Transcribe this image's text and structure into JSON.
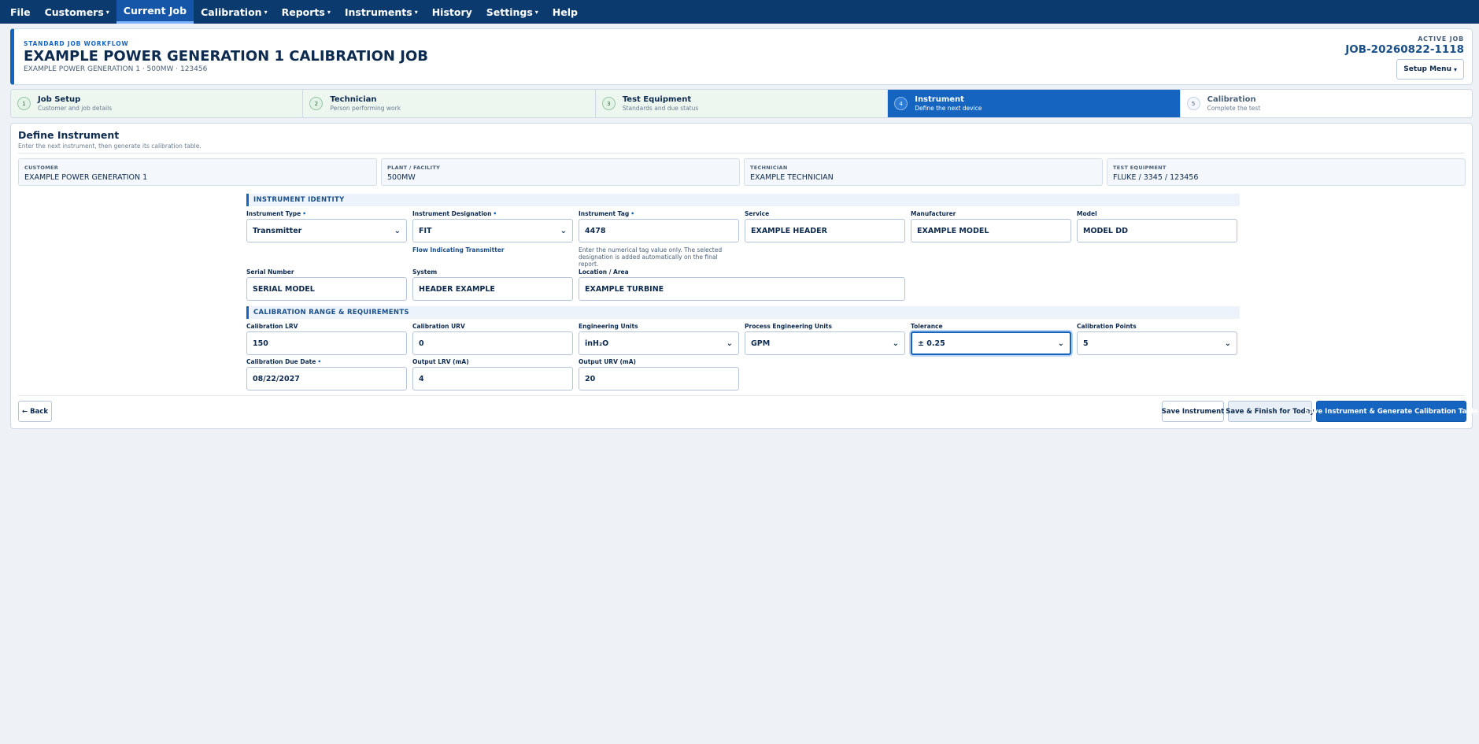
{
  "nav": {
    "items": [
      {
        "label": "File",
        "dropdown": false,
        "active": false
      },
      {
        "label": "Customers",
        "dropdown": true,
        "active": false
      },
      {
        "label": "Current Job",
        "dropdown": false,
        "active": true
      },
      {
        "label": "Calibration",
        "dropdown": true,
        "active": false
      },
      {
        "label": "Reports",
        "dropdown": true,
        "active": false
      },
      {
        "label": "Instruments",
        "dropdown": true,
        "active": false
      },
      {
        "label": "History",
        "dropdown": false,
        "active": false
      },
      {
        "label": "Settings",
        "dropdown": true,
        "active": false
      },
      {
        "label": "Help",
        "dropdown": false,
        "active": false
      }
    ]
  },
  "header": {
    "kicker": "STANDARD JOB WORKFLOW",
    "title": "EXAMPLE POWER GENERATION 1 CALIBRATION JOB",
    "subtitle": "EXAMPLE POWER GENERATION 1 · 500MW · 123456",
    "active_label": "ACTIVE JOB",
    "job_id": "JOB-20260822-1118",
    "setup_menu": "Setup Menu"
  },
  "steps": [
    {
      "num": "1",
      "title": "Job Setup",
      "desc": "Customer and job details",
      "active": false
    },
    {
      "num": "2",
      "title": "Technician",
      "desc": "Person performing work",
      "active": false
    },
    {
      "num": "3",
      "title": "Test Equipment",
      "desc": "Standards and due status",
      "active": false
    },
    {
      "num": "4",
      "title": "Instrument",
      "desc": "Define the next device",
      "active": true
    },
    {
      "num": "5",
      "title": "Calibration",
      "desc": "Complete the test",
      "active": false
    }
  ],
  "main": {
    "title": "Define Instrument",
    "subtitle": "Enter the next instrument, then generate its calibration table.",
    "info": [
      {
        "label": "CUSTOMER",
        "value": "EXAMPLE POWER GENERATION 1"
      },
      {
        "label": "PLANT / FACILITY",
        "value": "500MW"
      },
      {
        "label": "TECHNICIAN",
        "value": "EXAMPLE TECHNICIAN"
      },
      {
        "label": "TEST EQUIPMENT",
        "value": "FLUKE / 3345 / 123456"
      }
    ],
    "identity": {
      "header": "INSTRUMENT IDENTITY",
      "instrument_type": {
        "label": "Instrument Type",
        "value": "Transmitter"
      },
      "designation": {
        "label": "Instrument Designation",
        "value": "FIT",
        "hint": "Flow Indicating Transmitter"
      },
      "tag": {
        "label": "Instrument Tag",
        "value": "4478",
        "hint": "Enter the numerical tag value only. The selected designation is added automatically on the final report."
      },
      "service": {
        "label": "Service",
        "value": "EXAMPLE HEADER"
      },
      "manufacturer": {
        "label": "Manufacturer",
        "value": "EXAMPLE MODEL"
      },
      "model": {
        "label": "Model",
        "value": "MODEL DD"
      },
      "serial": {
        "label": "Serial Number",
        "value": "SERIAL MODEL"
      },
      "system": {
        "label": "System",
        "value": "HEADER EXAMPLE"
      },
      "location": {
        "label": "Location / Area",
        "value": "EXAMPLE TURBINE"
      }
    },
    "range": {
      "header": "CALIBRATION RANGE & REQUIREMENTS",
      "lrv": {
        "label": "Calibration LRV",
        "value": "150"
      },
      "urv": {
        "label": "Calibration URV",
        "value": "0"
      },
      "eng_units": {
        "label": "Engineering Units",
        "value": "inH₂O"
      },
      "proc_units": {
        "label": "Process Engineering Units",
        "value": "GPM"
      },
      "tolerance": {
        "label": "Tolerance",
        "value": "± 0.25"
      },
      "points": {
        "label": "Calibration Points",
        "value": "5"
      },
      "due_date": {
        "label": "Calibration Due Date",
        "value": "08/22/2027"
      },
      "out_lrv": {
        "label": "Output LRV (mA)",
        "value": "4"
      },
      "out_urv": {
        "label": "Output URV (mA)",
        "value": "20"
      }
    },
    "buttons": {
      "back": "← Back",
      "save": "Save Instrument",
      "save_finish": "Save & Finish for Today",
      "save_generate": "Save Instrument & Generate Calibration Table"
    }
  },
  "colors": {
    "nav_bg": "#0a3a6e",
    "accent": "#1565c0",
    "page_bg": "#eef2f7",
    "step_done_bg": "#edf6ef"
  }
}
